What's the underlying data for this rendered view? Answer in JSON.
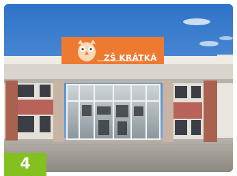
{
  "photo": {
    "sign_text": "ZŠ KRÁTKÁ",
    "sign_color": "#ee7a32",
    "sky_color": "#3d7fd0"
  },
  "badge": {
    "number": "4",
    "color": "#84c01f"
  }
}
